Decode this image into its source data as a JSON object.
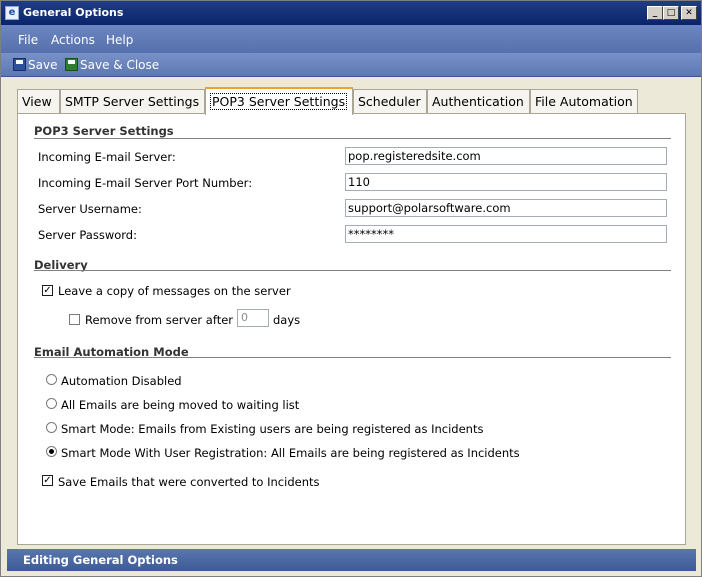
{
  "window": {
    "title": "General Options",
    "icon": "app-icon",
    "controls": [
      "minimize",
      "maximize",
      "close"
    ]
  },
  "menu": {
    "file": "File",
    "actions": "Actions",
    "help": "Help"
  },
  "toolbar": {
    "save": "Save",
    "save_close": "Save & Close"
  },
  "tabs": [
    {
      "label": "View"
    },
    {
      "label": "SMTP Server Settings"
    },
    {
      "label": "POP3 Server Settings",
      "active": true
    },
    {
      "label": "Scheduler"
    },
    {
      "label": "Authentication"
    },
    {
      "label": "File Automation"
    }
  ],
  "pop3": {
    "title": "POP3 Server Settings",
    "server_label": "Incoming E-mail Server:",
    "server_value": "pop.registeredsite.com",
    "port_label": "Incoming E-mail Server Port Number:",
    "port_value": "110",
    "username_label": "Server Username:",
    "username_value": "support@polarsoftware.com",
    "password_label": "Server Password:",
    "password_value": "********"
  },
  "delivery": {
    "title": "Delivery",
    "leave_copy_label": "Leave a copy of messages on the server",
    "leave_copy_checked": true,
    "remove_label": "Remove from server after",
    "remove_checked": false,
    "remove_days": "0",
    "days_label": "days"
  },
  "automation": {
    "title": "Email Automation Mode",
    "options": [
      {
        "label": "Automation Disabled",
        "selected": false
      },
      {
        "label": "All Emails are being moved to waiting list",
        "selected": false
      },
      {
        "label": "Smart Mode: Emails from Existing users are being registered as Incidents",
        "selected": false
      },
      {
        "label": "Smart Mode With User Registration: All Emails are being registered as Incidents",
        "selected": true
      }
    ],
    "save_converted_label": "Save Emails that were converted to Incidents",
    "save_converted_checked": true
  },
  "status": {
    "text": "Editing General Options"
  },
  "colors": {
    "titlebar": "#0a246a",
    "menubar": "#5670ad",
    "active_tab_accent": "#f0a030",
    "statusbar": "#3f5b96"
  }
}
